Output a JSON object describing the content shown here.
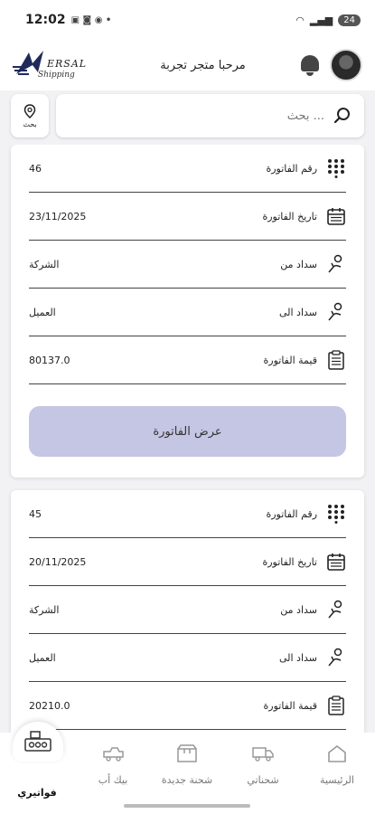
{
  "status_bar": {
    "time": "12:02",
    "battery": "24"
  },
  "header": {
    "brand_name": "ERSAL",
    "brand_sub": "Shipping",
    "greeting": "مرحبا متجر تجربة"
  },
  "search": {
    "placeholder": "بحث ...",
    "location_label": "بحث"
  },
  "invoices": [
    {
      "number_label": "رقم الفاتورة",
      "number": "46",
      "date_label": "تاريخ الفاتورة",
      "date": "23/11/2025",
      "pay_from_label": "سداد من",
      "pay_from": "الشركة",
      "pay_to_label": "سداد الى",
      "pay_to": "العميل",
      "amount_label": "قيمة الفاتورة",
      "amount": "80137.0",
      "button_label": "عرض الفاتورة"
    },
    {
      "number_label": "رقم الفاتورة",
      "number": "45",
      "date_label": "تاريخ الفاتورة",
      "date": "20/11/2025",
      "pay_from_label": "سداد من",
      "pay_from": "الشركة",
      "pay_to_label": "سداد الى",
      "pay_to": "العميل",
      "amount_label": "قيمة الفاتورة",
      "amount": "20210.0"
    }
  ],
  "nav": {
    "home": "الرئيسية",
    "shipments": "شحناتي",
    "new_shipment": "شحنة جديدة",
    "pickup": "بيك أب",
    "invoices": "فواتيري"
  }
}
